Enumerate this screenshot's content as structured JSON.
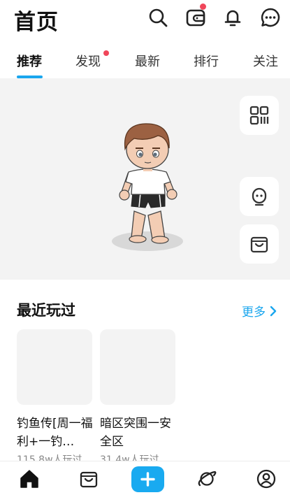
{
  "header": {
    "title": "首页",
    "icons": [
      "search-icon",
      "wallet-icon",
      "bell-icon",
      "chat-icon"
    ]
  },
  "tabs": [
    {
      "label": "推荐",
      "active": true
    },
    {
      "label": "发现",
      "badge": true
    },
    {
      "label": "最新"
    },
    {
      "label": "排行"
    },
    {
      "label": "关注"
    }
  ],
  "stage": {
    "side_buttons": [
      "qr-scan-icon",
      "avatar-edit-icon",
      "shop-bag-icon"
    ]
  },
  "recent": {
    "title": "最近玩过",
    "more_label": "更多",
    "games": [
      {
        "name": "钓鱼传[周一福利+一钓…",
        "plays": "115.8w人玩过"
      },
      {
        "name": "暗区突围一安全区",
        "plays": "31.4w人玩过"
      }
    ]
  },
  "bottom_nav": [
    "home-icon",
    "shop-icon",
    "create-icon",
    "planet-icon",
    "profile-icon"
  ],
  "colors": {
    "accent": "#1aa6ee",
    "badge": "#f0465a",
    "stage_bg": "#f3f3f3"
  }
}
